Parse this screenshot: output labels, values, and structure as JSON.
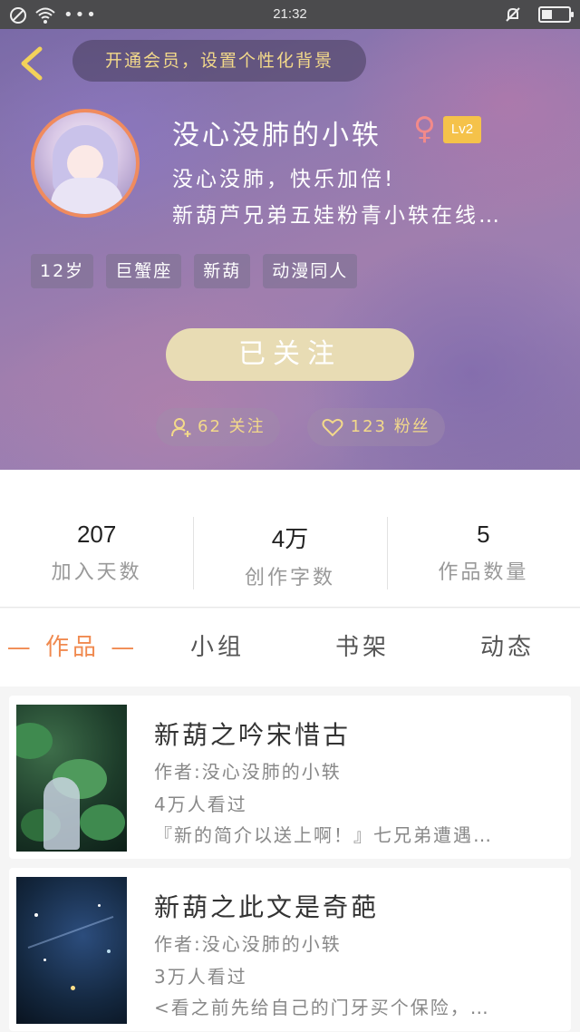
{
  "status_bar": {
    "time": "21:32",
    "battery_level": 0.4
  },
  "header": {
    "vip_banner": "开通会员，设置个性化背景",
    "nickname": "没心没肺的小轶",
    "gender_symbol": "♀",
    "level": "Lv2",
    "bio_line1": "没心没肺，快乐加倍!",
    "bio_line2": "新葫芦兄弟五娃粉青小轶在线…",
    "tags": [
      "12岁",
      "巨蟹座",
      "新葫",
      "动漫同人"
    ],
    "follow_button": "已关注",
    "following": "62 关注",
    "fans": "123 粉丝"
  },
  "stats": [
    {
      "value": "207",
      "label": "加入天数"
    },
    {
      "value": "4万",
      "label": "创作字数"
    },
    {
      "value": "5",
      "label": "作品数量"
    }
  ],
  "tabs": [
    "— 作品 —",
    "小组",
    "书架",
    "动态"
  ],
  "works": [
    {
      "title": "新葫之吟宋惜古",
      "author": "作者:没心没肺的小轶",
      "views": "4万人看过",
      "desc": "『新的简介以送上啊！』七兄弟遭遇…"
    },
    {
      "title": "新葫之此文是奇葩",
      "author": "作者:没心没肺的小轶",
      "views": "3万人看过",
      "desc": "<看之前先给自己的门牙买个保险，…"
    }
  ],
  "colors": {
    "accent": "#f08a50",
    "gold": "#f3d98a",
    "level_badge": "#f5c24a"
  }
}
